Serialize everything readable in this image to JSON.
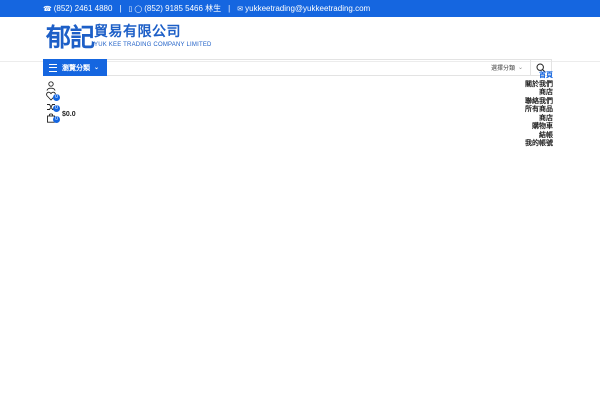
{
  "topbar": {
    "phone": "(852) 2461 4880",
    "separator": "|",
    "whatsapp": "(852) 9185 5466 林生",
    "email": "yukkeetrading@yukkeetrading.com"
  },
  "logo": {
    "mark": "郁記",
    "chinese_name": "貿易有限公司",
    "english_name": "YUK KEE TRADING COMPANY LIMITED"
  },
  "search": {
    "category_button": "瀏覽分類",
    "placeholder": "",
    "select_label": "選擇分類"
  },
  "header_icons": {
    "wishlist_count": "0",
    "compare_count": "0",
    "cart_count": "0",
    "cart_total": "$0.0"
  },
  "menu": {
    "items": [
      "首頁",
      "關於我們",
      "商店",
      "聯絡我們",
      "所有商品",
      "商店",
      "購物車",
      "結帳",
      "我的帳號"
    ]
  },
  "colors": {
    "accent": "#1566e0",
    "text": "#222222"
  }
}
